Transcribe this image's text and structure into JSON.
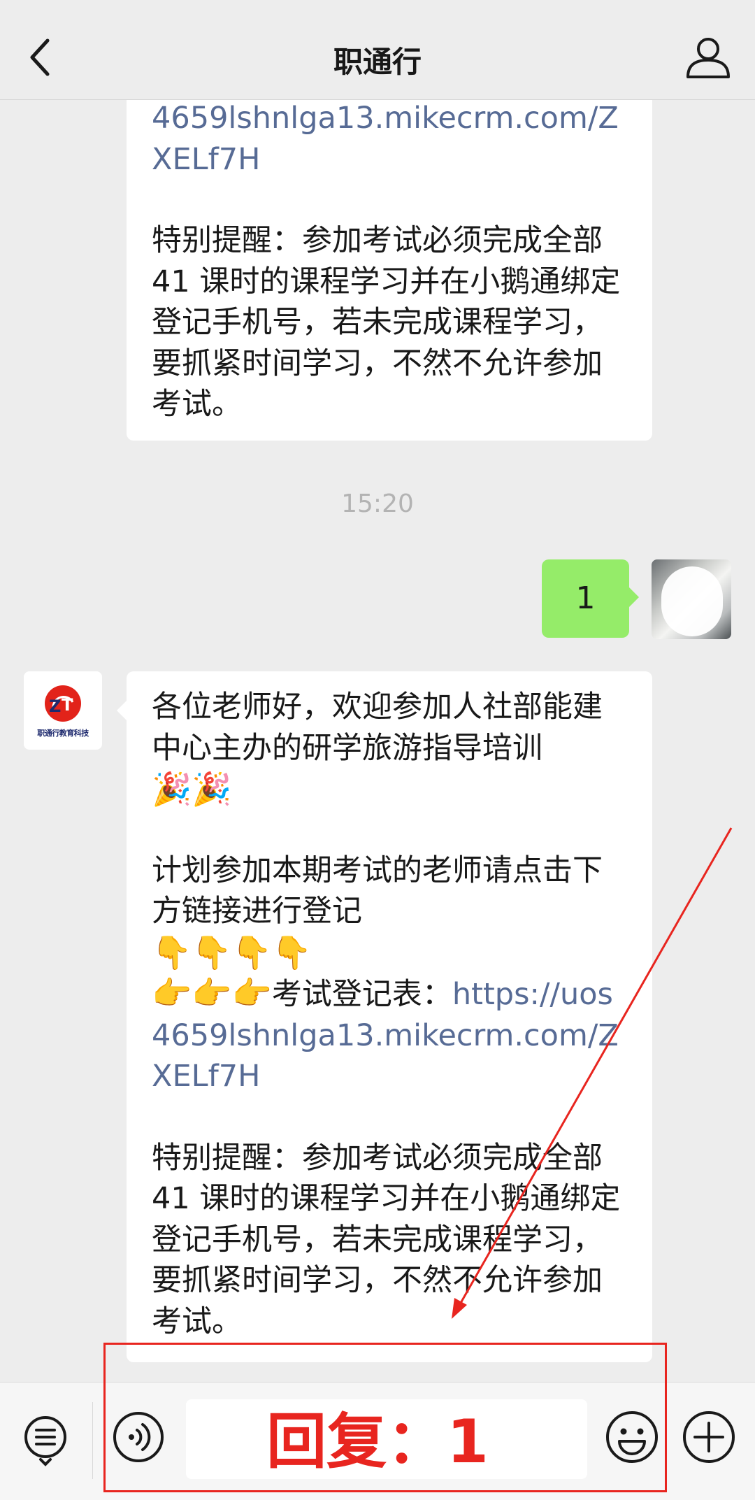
{
  "header": {
    "title": "职通行",
    "back_icon": "chevron-left-icon",
    "profile_icon": "person-icon"
  },
  "messages": {
    "first": {
      "link_tail": "4659lshnlga13.mikecrm.com/ZXELf7H",
      "reminder": "特别提醒：参加考试必须完成全部 41 课时的课程学习并在小鹅通绑定登记手机号，若未完成课程学习，要抓紧时间学习，不然不允许参加考试。"
    },
    "timestamp": "15:20",
    "user_reply": "1",
    "bot": {
      "avatar_logo_text": "职通行教育科技",
      "greeting": "各位老师好，欢迎参加人社部能建中心主办的研学旅游指导培训",
      "greeting_emoji": "🎉🎉",
      "plan": "计划参加本期考试的老师请点击下方链接进行登记",
      "point_down": "👇👇👇👇",
      "point_right": "👉👉👉",
      "form_label": "考试登记表：",
      "form_link": "https://uos4659lshnlga13.mikecrm.com/ZXELf7H",
      "reminder": "特别提醒：参加考试必须完成全部 41 课时的课程学习并在小鹅通绑定登记手机号，若未完成课程学习，要抓紧时间学习，不然不允许参加考试。"
    }
  },
  "bottom_bar": {
    "menu_icon": "list-menu-icon",
    "voice_icon": "voice-icon",
    "emoji_icon": "smiley-icon",
    "plus_icon": "plus-icon",
    "input_value": ""
  },
  "annotation": {
    "text": "回复：1",
    "color": "#e8251f"
  },
  "colors": {
    "background": "#ededed",
    "user_bubble": "#95ec69",
    "link": "#576b95"
  }
}
